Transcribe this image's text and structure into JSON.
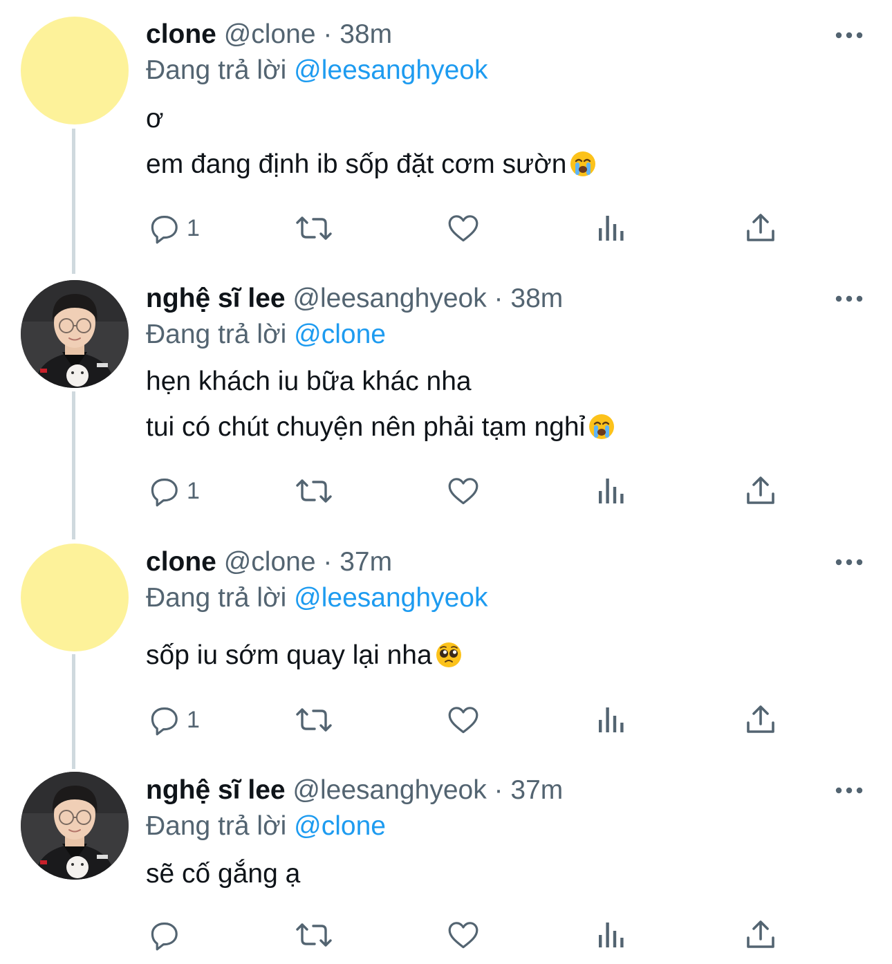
{
  "tweets": [
    {
      "display_name": "clone",
      "handle": "@clone",
      "separator": "·",
      "time": "38m",
      "replying_prefix": "Đang trả lời",
      "replying_to": "@leesanghyeok",
      "avatar": "yellow-circle",
      "lines": [
        "ơ",
        "em đang định ib sốp đặt cơm sườn"
      ],
      "line_emoji": [
        null,
        "loudly-crying-face"
      ],
      "reply_count": "1"
    },
    {
      "display_name": "nghệ sĩ lee",
      "handle": "@leesanghyeok",
      "separator": "·",
      "time": "38m",
      "replying_prefix": "Đang trả lời",
      "replying_to": "@clone",
      "avatar": "profile-photo",
      "lines": [
        "hẹn khách iu bữa khác nha",
        "tui có chút chuyện nên phải tạm nghỉ"
      ],
      "line_emoji": [
        null,
        "loudly-crying-face"
      ],
      "reply_count": "1"
    },
    {
      "display_name": "clone",
      "handle": "@clone",
      "separator": "·",
      "time": "37m",
      "replying_prefix": "Đang trả lời",
      "replying_to": "@leesanghyeok",
      "avatar": "yellow-circle",
      "lines": [
        "sốp iu sớm quay lại nha"
      ],
      "line_emoji": [
        "pleading-face"
      ],
      "reply_count": "1"
    },
    {
      "display_name": "nghệ sĩ lee",
      "handle": "@leesanghyeok",
      "separator": "·",
      "time": "37m",
      "replying_prefix": "Đang trả lời",
      "replying_to": "@clone",
      "avatar": "profile-photo",
      "lines": [
        "sẽ cố gắng ạ"
      ],
      "line_emoji": [
        null
      ],
      "reply_count": ""
    }
  ],
  "icons": {
    "more": "more-horizontal-icon",
    "reply": "reply-bubble-icon",
    "retweet": "retweet-icon",
    "like": "heart-icon",
    "views": "views-bar-chart-icon",
    "share": "share-upload-icon"
  },
  "colors": {
    "text": "#0f1419",
    "secondary": "#536471",
    "link": "#1d9bf0",
    "thread_line": "#cfd9de",
    "avatar_yellow": "#fdf29a"
  }
}
